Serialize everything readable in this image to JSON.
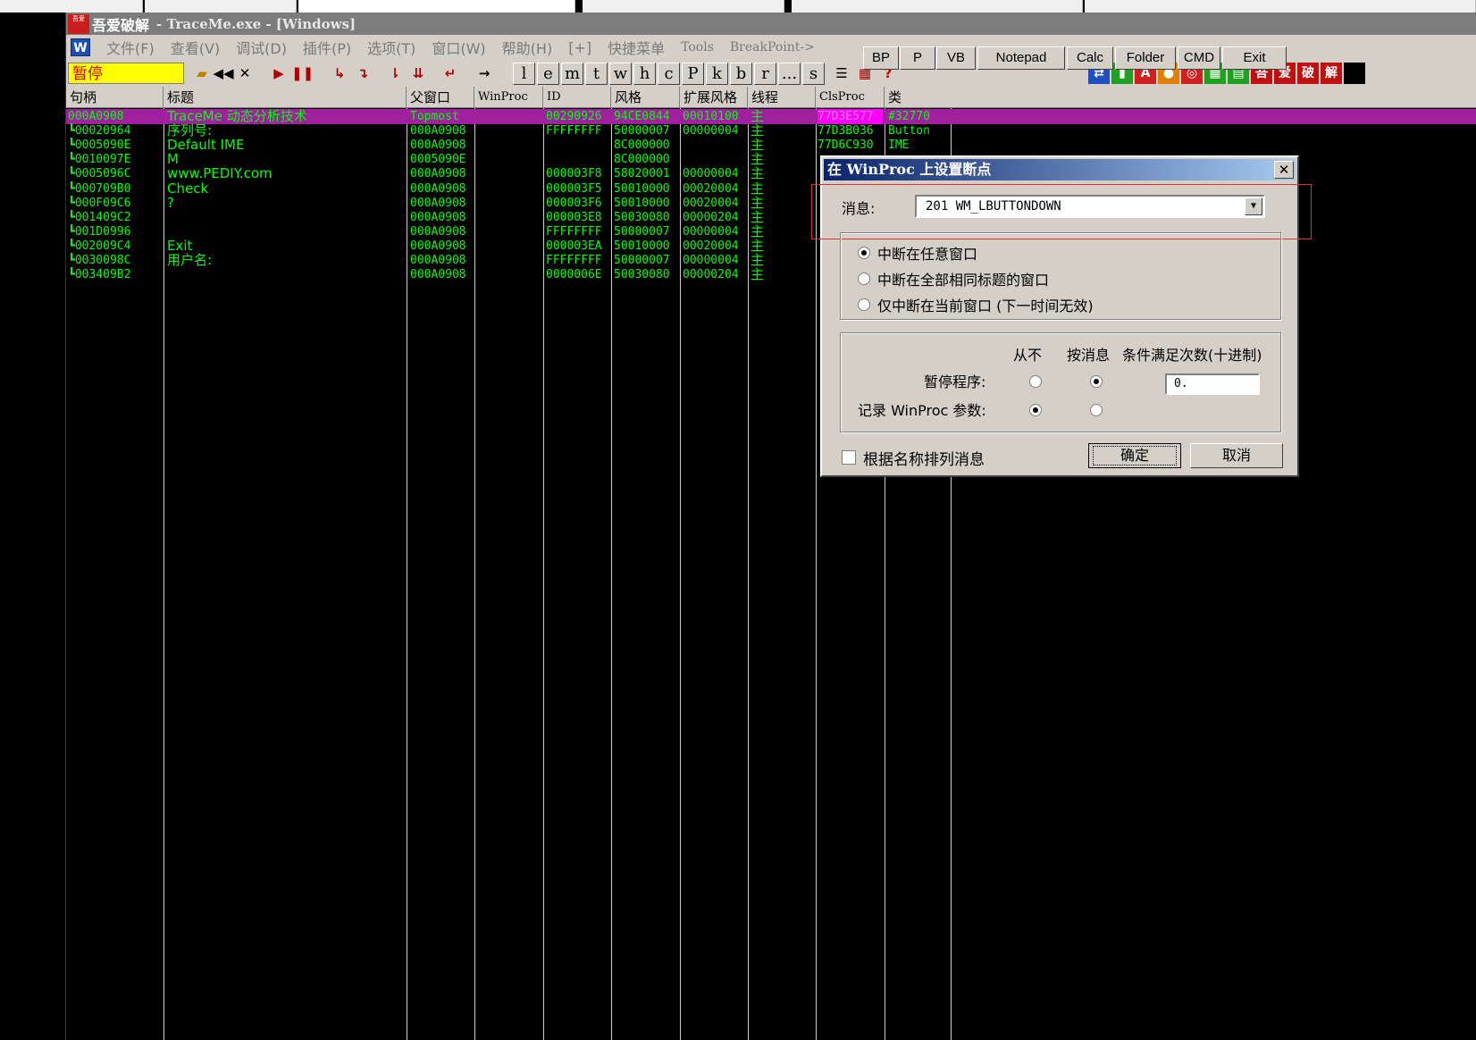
{
  "window": {
    "app_name": "吾爱破解",
    "title_rest": "- TraceMe.exe - [Windows]",
    "logo_text": "吾爱"
  },
  "menu": [
    "文件(F)",
    "查看(V)",
    "调试(D)",
    "插件(P)",
    "选项(T)",
    "窗口(W)",
    "帮助(H)",
    "[+]",
    "快捷菜单",
    "Tools",
    "BreakPoint->"
  ],
  "quick_buttons": [
    "BP",
    "P",
    "VB",
    "Notepad",
    "Calc",
    "Folder",
    "CMD",
    "Exit"
  ],
  "toolbar": {
    "state": "暂停",
    "letter_buttons": [
      "l",
      "e",
      "m",
      "t",
      "w",
      "h",
      "c",
      "P",
      "k",
      "b",
      "r",
      "...",
      "s"
    ]
  },
  "columns": [
    "句柄",
    "标题",
    "父窗口",
    "WinProc",
    "ID",
    "风格",
    "扩展风格",
    "线程",
    "ClsProc",
    "类"
  ],
  "rows": [
    {
      "handle": "000A0908",
      "title": "TraceMe 动态分析技术",
      "parent": "Topmost",
      "winproc": "",
      "id": "00290926",
      "style": "94CE0844",
      "exstyle": "00010100",
      "thread": "主",
      "clsproc": "77D3E577",
      "cls": "#32770",
      "selected": true
    },
    {
      "handle": "00020964",
      "title": "序列号:",
      "parent": "000A0908",
      "winproc": "",
      "id": "FFFFFFFF",
      "style": "50000007",
      "exstyle": "00000004",
      "thread": "主",
      "clsproc": "77D3B036",
      "cls": "Button"
    },
    {
      "handle": "0005090E",
      "title": "Default IME",
      "parent": "000A0908",
      "winproc": "",
      "id": "",
      "style": "8C000000",
      "exstyle": "",
      "thread": "主",
      "clsproc": "77D6C930",
      "cls": "IME"
    },
    {
      "handle": "0010097E",
      "title": "M",
      "parent": "0005090E",
      "winproc": "",
      "id": "",
      "style": "8C000000",
      "exstyle": "",
      "thread": "主",
      "clsproc": "",
      "cls": ""
    },
    {
      "handle": "0005096C",
      "title": "www.PEDIY.com",
      "parent": "000A0908",
      "winproc": "",
      "id": "000003F8",
      "style": "58020001",
      "exstyle": "00000004",
      "thread": "主",
      "clsproc": "",
      "cls": ""
    },
    {
      "handle": "000709B0",
      "title": "Check",
      "parent": "000A0908",
      "winproc": "",
      "id": "000003F5",
      "style": "50010000",
      "exstyle": "00020004",
      "thread": "主",
      "clsproc": "",
      "cls": ""
    },
    {
      "handle": "000F09C6",
      "title": "?",
      "parent": "000A0908",
      "winproc": "",
      "id": "000003F6",
      "style": "50010000",
      "exstyle": "00020004",
      "thread": "主",
      "clsproc": "",
      "cls": ""
    },
    {
      "handle": "001409C2",
      "title": "",
      "parent": "000A0908",
      "winproc": "",
      "id": "000003E8",
      "style": "50030080",
      "exstyle": "00000204",
      "thread": "主",
      "clsproc": "",
      "cls": ""
    },
    {
      "handle": "001D0996",
      "title": "",
      "parent": "000A0908",
      "winproc": "",
      "id": "FFFFFFFF",
      "style": "50000007",
      "exstyle": "00000004",
      "thread": "主",
      "clsproc": "",
      "cls": ""
    },
    {
      "handle": "002009C4",
      "title": "Exit",
      "parent": "000A0908",
      "winproc": "",
      "id": "000003EA",
      "style": "50010000",
      "exstyle": "00020004",
      "thread": "主",
      "clsproc": "",
      "cls": ""
    },
    {
      "handle": "0030098C",
      "title": "用户名:",
      "parent": "000A0908",
      "winproc": "",
      "id": "FFFFFFFF",
      "style": "50000007",
      "exstyle": "00000004",
      "thread": "主",
      "clsproc": "",
      "cls": ""
    },
    {
      "handle": "003409B2",
      "title": "",
      "parent": "000A0908",
      "winproc": "",
      "id": "0000006E",
      "style": "50030080",
      "exstyle": "00000204",
      "thread": "主",
      "clsproc": "",
      "cls": ""
    }
  ],
  "dialog": {
    "title": "在 WinProc 上设置断点",
    "close_glyph": "✕",
    "message_label": "消息:",
    "message_value": "201 WM_LBUTTONDOWN",
    "radio_options": [
      "中断在任意窗口",
      "中断在全部相同标题的窗口",
      "仅中断在当前窗口 (下一时间无效)"
    ],
    "radio_selected": 0,
    "col_never": "从不",
    "col_on_msg": "按消息",
    "col_cond": "条件满足次数(十进制)",
    "pause_label": "暂停程序:",
    "log_label": "记录 WinProc 参数:",
    "count_value": "0.",
    "sort_label": "根据名称排列消息",
    "ok": "确定",
    "cancel": "取消"
  }
}
